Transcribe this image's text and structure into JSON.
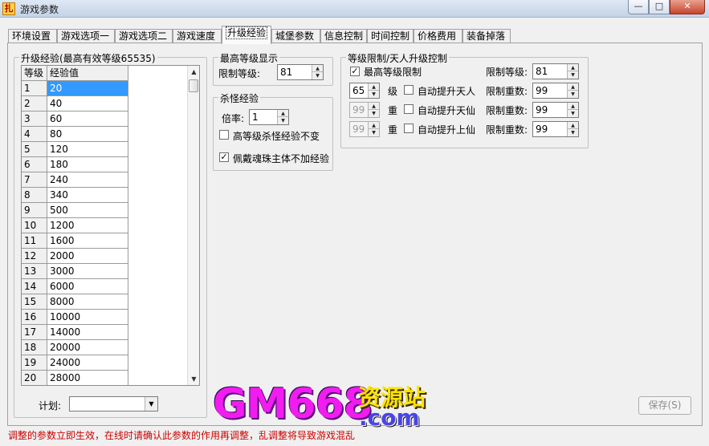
{
  "window": {
    "title": "游戏参数",
    "min_glyph": "—",
    "max_glyph": "□",
    "close_glyph": "✕"
  },
  "tabs": [
    "环境设置",
    "游戏选项一",
    "游戏选项二",
    "游戏速度",
    "升级经验",
    "城堡参数",
    "信息控制",
    "时间控制",
    "价格费用",
    "装备掉落"
  ],
  "active_tab": "升级经验",
  "exp_group": {
    "title": "升级经验(最高有效等级65535)",
    "headers": [
      "等级",
      "经验值"
    ],
    "rows": [
      [
        "1",
        "20"
      ],
      [
        "2",
        "40"
      ],
      [
        "3",
        "60"
      ],
      [
        "4",
        "80"
      ],
      [
        "5",
        "120"
      ],
      [
        "6",
        "180"
      ],
      [
        "7",
        "240"
      ],
      [
        "8",
        "340"
      ],
      [
        "9",
        "500"
      ],
      [
        "10",
        "1200"
      ],
      [
        "11",
        "1600"
      ],
      [
        "12",
        "2000"
      ],
      [
        "13",
        "3000"
      ],
      [
        "14",
        "6000"
      ],
      [
        "15",
        "8000"
      ],
      [
        "16",
        "10000"
      ],
      [
        "17",
        "14000"
      ],
      [
        "18",
        "20000"
      ],
      [
        "19",
        "24000"
      ],
      [
        "20",
        "28000"
      ]
    ],
    "plan_label": "计划:",
    "plan_value": ""
  },
  "max_level_display": {
    "title": "最高等级显示",
    "limit_label": "限制等级:",
    "limit_value": "81"
  },
  "kill_exp": {
    "title": "杀怪经验",
    "rate_label": "倍率:",
    "rate_value": "1",
    "high_level_label": "高等级杀怪经验不变",
    "high_level_checked": false,
    "soul_bead_label": "佩戴魂珠主体不加经验",
    "soul_bead_checked": true
  },
  "level_limit": {
    "title": "等级限制/天人升级控制",
    "max_level_limit_label": "最高等级限制",
    "max_level_limit_checked": true,
    "limit_level_label": "限制等级:",
    "limit_level_value": "81",
    "rows": [
      {
        "value": "65",
        "unit": "级",
        "auto_label": "自动提升天人",
        "limit_label": "限制重数:",
        "limit_value": "99",
        "enabled": true
      },
      {
        "value": "99",
        "unit": "重",
        "auto_label": "自动提升天仙",
        "limit_label": "限制重数:",
        "limit_value": "99",
        "enabled": false
      },
      {
        "value": "99",
        "unit": "重",
        "auto_label": "自动提升上仙",
        "limit_label": "限制重数:",
        "limit_value": "99",
        "enabled": false
      }
    ]
  },
  "save_button": "保存(S)",
  "logo": {
    "main": "GM668",
    "chinese": "资源站",
    "domain": ".com"
  },
  "status": "调整的参数立即生效，在线时请确认此参数的作用再调整，乱调整将导致游戏混乱"
}
